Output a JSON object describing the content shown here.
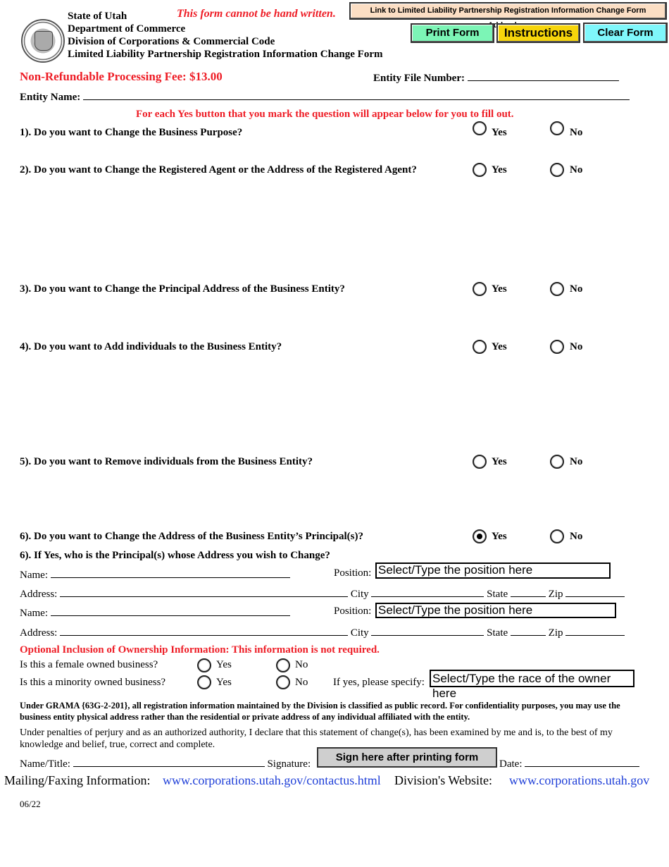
{
  "header": {
    "lines": [
      "State of Utah",
      "Department of Commerce",
      "Division of Corporations & Commercial Code",
      "Limited Liability Partnership Registration Information Change Form"
    ],
    "warning": "This form cannot be hand written.",
    "seal_icon": "state-seal-icon"
  },
  "toolbar": {
    "addendum_link": "Link to Limited Liability Partnership Registration Information Change Form Addendum",
    "print_label": "Print Form",
    "instructions_label": "Instructions",
    "clear_label": "Clear Form",
    "colors": {
      "addendum": "#fbdec4",
      "print": "#7cf5b6",
      "instructions": "#f6d50b",
      "clear": "#7ff7fb"
    }
  },
  "fee": "Non-Refundable Processing Fee: $13.00",
  "entity_file_number": {
    "label": "Entity File Number:",
    "value": ""
  },
  "entity_name": {
    "label": "Entity Name:",
    "value": ""
  },
  "instruction_note": "For each Yes button that you mark the question will appear below for you to fill out.",
  "radio_labels": {
    "yes": "Yes",
    "no": "No"
  },
  "questions": [
    {
      "text": "1). Do you want to Change the Business Purpose?",
      "selected": "none"
    },
    {
      "text": "2). Do you want to Change the Registered Agent or the Address of the Registered Agent?",
      "selected": "none"
    },
    {
      "text": "3). Do you want to Change the Principal Address of the Business Entity?",
      "selected": "none"
    },
    {
      "text": "4). Do you want to Add individuals to the Business Entity?",
      "selected": "none"
    },
    {
      "text": "5). Do you want to Remove individuals from the Business Entity?",
      "selected": "none"
    },
    {
      "text": "6). Do you want to Change the Address of the Business Entity’s Principal(s)?",
      "selected": "yes"
    }
  ],
  "principals": {
    "heading": "6). If Yes, who is the Principal(s) whose Address you wish to Change?",
    "labels": {
      "name": "Name:",
      "position": "Position:",
      "address": "Address:",
      "city": "City",
      "state": "State",
      "zip": "Zip"
    },
    "position_placeholder": "Select/Type the position here",
    "rows": [
      {
        "name": "",
        "position": "Select/Type the position here",
        "address": "",
        "city": "",
        "state": "",
        "zip": ""
      },
      {
        "name": "",
        "position": "Select/Type the position here",
        "address": "",
        "city": "",
        "state": "",
        "zip": ""
      }
    ]
  },
  "ownership": {
    "heading": "Optional Inclusion of Ownership Information:  This information is not required.",
    "female_q": "Is this a female owned business?",
    "minority_q": "Is this a minority owned business?",
    "specify_label": "If yes, please specify:",
    "race_value": "Select/Type the race of the owner here"
  },
  "grama_notice": "Under GRAMA {63G-2-201}, all registration information maintained by the Division is classified as public record.  For confidentiality purposes, you may use the business entity physical address rather than the residential or private address of any individual affiliated with the entity.",
  "perjury_statement": "Under penalties of perjury and as an authorized authority, I declare that this statement of change(s), has been examined by me and is, to the best of my knowledge and belief, true, correct and complete.",
  "signature": {
    "name_title_label": "Name/Title:",
    "signature_label": "Signature:",
    "sign_button": "Sign here after printing form",
    "date_label": "Date:"
  },
  "footer": {
    "mailing_label": "Mailing/Faxing Information:",
    "mailing_link": "www.corporations.utah.gov/contactus.html",
    "website_label": "Division's Website:",
    "website_link": "www.corporations.utah.gov",
    "revision": "06/22"
  }
}
